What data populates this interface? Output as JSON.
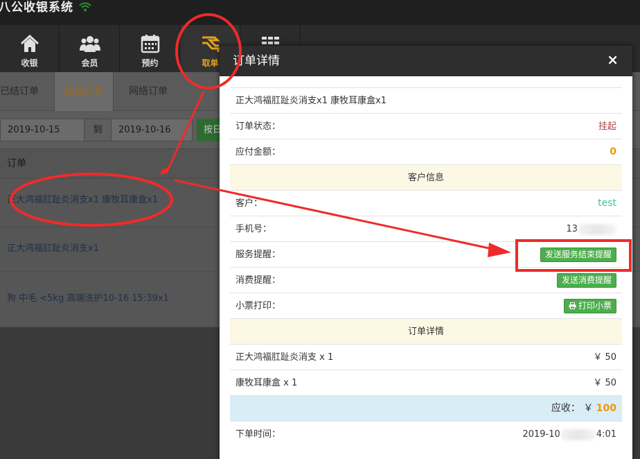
{
  "app": {
    "title": "八公收银系统",
    "wifi_icon": "wifi-icon"
  },
  "nav": {
    "items": [
      {
        "label": "收银",
        "icon": "home-icon"
      },
      {
        "label": "会员",
        "icon": "users-icon"
      },
      {
        "label": "预约",
        "icon": "calendar-icon"
      },
      {
        "label": "取单",
        "icon": "take-order-icon"
      },
      {
        "label": "",
        "icon": "grid-icon"
      }
    ],
    "active_index": 3
  },
  "tabs": [
    {
      "label": "已结订单"
    },
    {
      "label": "挂起订单"
    },
    {
      "label": "网络订单"
    }
  ],
  "filter": {
    "start_date": "2019-10-15",
    "to_label": "到",
    "end_date": "2019-10-16",
    "query_label": "按日"
  },
  "list": {
    "header": "订单",
    "rows": [
      {
        "text": "正大鸿福肛趾炎消支x1 康牧耳康盒x1"
      },
      {
        "text": "正大鸿福肛趾炎消支x1"
      },
      {
        "text": "狗 中毛 <5kg 高端洗护10-16 15:39x1"
      }
    ]
  },
  "modal": {
    "title": "订单详情",
    "close": "×",
    "summary": "正大鸿福肛趾炎消支x1 康牧耳康盒x1",
    "status_label": "订单状态：",
    "status_value": "挂起",
    "payable_label": "应付金额：",
    "payable_value": "0",
    "customer_section": "客户信息",
    "customer_label": "客户：",
    "customer_value": "test",
    "phone_label": "手机号：",
    "phone_value": "13",
    "service_label": "服务提醒：",
    "service_button": "发送服务结束提醒",
    "consume_label": "消费提醒：",
    "consume_button": "发送消费提醒",
    "receipt_label": "小票打印：",
    "receipt_button": "打印小票",
    "detail_section": "订单详情",
    "items": [
      {
        "name": "正大鸿福肛趾炎消支 x 1",
        "price": "￥ 50"
      },
      {
        "name": "康牧耳康盒 x 1",
        "price": "￥ 50"
      }
    ],
    "total_label": "应收：",
    "total_currency": "￥",
    "total_value": "100",
    "time_label": "下单时间：",
    "time_prefix": "2019-10",
    "time_suffix": "4:01"
  },
  "colors": {
    "accent": "#e6a21c",
    "status_red": "#a94442",
    "amount_orange": "#f0960a",
    "customer_teal": "#3fbfa4",
    "btn_green": "#4cae4c",
    "annotation_red": "#ee2b2b"
  }
}
